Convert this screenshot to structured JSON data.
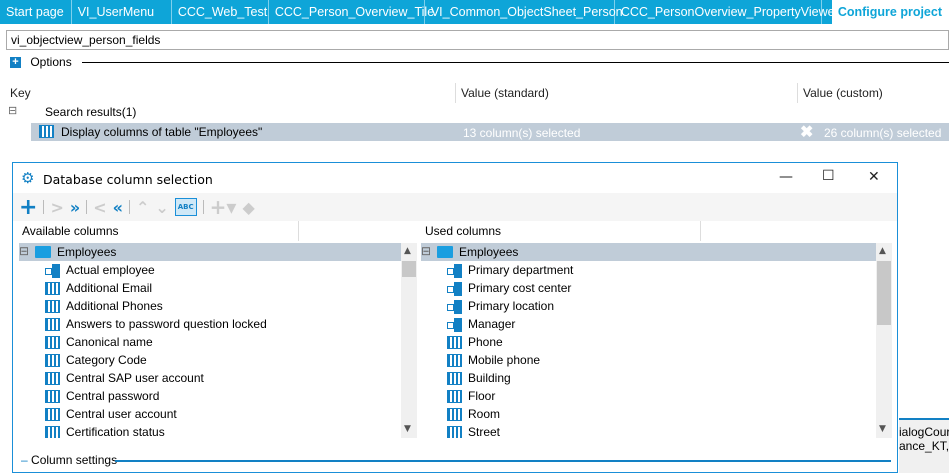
{
  "tabs": [
    "Start page",
    "VI_UserMenu",
    "CCC_Web_Test",
    "CCC_Person_Overview_Tile",
    "VI_Common_ObjectSheet_Person",
    "CCC_PersonOverview_PropertyViewer",
    "Configure project"
  ],
  "search_value": "vi_objectview_person_fields",
  "options_label": "Options",
  "grid": {
    "key": "Key",
    "value_standard": "Value (standard)",
    "value_custom": "Value (custom)",
    "root": "Search results(1)",
    "row": {
      "key": "Display columns of table \"Employees\"",
      "standard": "13 column(s) selected",
      "custom": "26 column(s) selected"
    }
  },
  "dialog": {
    "title": "Database column selection",
    "available_header": "Available columns",
    "used_header": "Used columns",
    "available_root": "Employees",
    "used_root": "Employees",
    "available": [
      {
        "t": "Actual employee",
        "icon": "fk"
      },
      {
        "t": "Additional Email",
        "icon": "col"
      },
      {
        "t": "Additional Phones",
        "icon": "col"
      },
      {
        "t": "Answers to password question locked",
        "icon": "col"
      },
      {
        "t": "Canonical name",
        "icon": "col"
      },
      {
        "t": "Category Code",
        "icon": "col"
      },
      {
        "t": "Central SAP user account",
        "icon": "col"
      },
      {
        "t": "Central password",
        "icon": "col"
      },
      {
        "t": "Central user account",
        "icon": "col"
      },
      {
        "t": "Certification status",
        "icon": "col"
      }
    ],
    "used": [
      {
        "t": "Primary department",
        "icon": "fk"
      },
      {
        "t": "Primary cost center",
        "icon": "fk"
      },
      {
        "t": "Primary location",
        "icon": "fk"
      },
      {
        "t": "Manager",
        "icon": "fk"
      },
      {
        "t": "Phone",
        "icon": "col"
      },
      {
        "t": "Mobile phone",
        "icon": "col"
      },
      {
        "t": "Building",
        "icon": "col"
      },
      {
        "t": "Floor",
        "icon": "col"
      },
      {
        "t": "Room",
        "icon": "col"
      },
      {
        "t": "Street",
        "icon": "col"
      }
    ],
    "toolbar_abc": "ABC",
    "column_settings": "Column settings"
  },
  "background_text": [
    "ialogCour",
    "ance_KT, C"
  ],
  "colors": {
    "accent": "#0ea5d8",
    "selection": "#c0ccd8",
    "icon": "#1280c4"
  }
}
